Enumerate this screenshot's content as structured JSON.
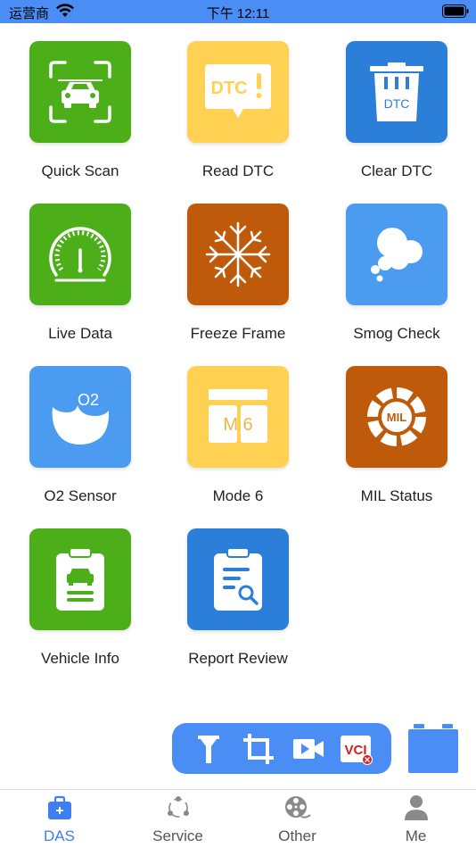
{
  "status_bar": {
    "carrier": "运营商",
    "time": "下午 12:11"
  },
  "colors": {
    "accent": "#4a8ef5",
    "green": "#4caf1a",
    "yellow": "#ffd152",
    "blue": "#2b7fd8",
    "light_blue": "#4b9cf0",
    "orange": "#bf5a0a"
  },
  "tiles": [
    {
      "label": "Quick Scan",
      "icon": "car-scan-icon",
      "icon_text": ""
    },
    {
      "label": "Read DTC",
      "icon": "dtc-message-icon",
      "icon_text": "DTC"
    },
    {
      "label": "Clear DTC",
      "icon": "trash-dtc-icon",
      "icon_text": "DTC"
    },
    {
      "label": "Live Data",
      "icon": "gauge-icon",
      "icon_text": ""
    },
    {
      "label": "Freeze Frame",
      "icon": "snowflake-icon",
      "icon_text": ""
    },
    {
      "label": "Smog Check",
      "icon": "smog-cloud-icon",
      "icon_text": ""
    },
    {
      "label": "O2 Sensor",
      "icon": "o2-drop-icon",
      "icon_text": "O2"
    },
    {
      "label": "Mode 6",
      "icon": "mode6-icon",
      "icon_text": "M 6"
    },
    {
      "label": "MIL Status",
      "icon": "mil-ring-icon",
      "icon_text": "MIL"
    },
    {
      "label": "Vehicle Info",
      "icon": "clipboard-car-icon",
      "icon_text": ""
    },
    {
      "label": "Report Review",
      "icon": "report-search-icon",
      "icon_text": ""
    }
  ],
  "toolbar": {
    "items": [
      {
        "icon": "filter-icon"
      },
      {
        "icon": "crop-icon"
      },
      {
        "icon": "video-icon"
      },
      {
        "icon": "vci-icon",
        "text": "VCI"
      }
    ]
  },
  "vci_status": {
    "icon": "battery-box-icon"
  },
  "tabs": [
    {
      "label": "DAS",
      "icon": "toolbox-icon",
      "active": true
    },
    {
      "label": "Service",
      "icon": "share-nodes-icon",
      "active": false
    },
    {
      "label": "Other",
      "icon": "film-reel-icon",
      "active": false
    },
    {
      "label": "Me",
      "icon": "person-icon",
      "active": false
    }
  ]
}
